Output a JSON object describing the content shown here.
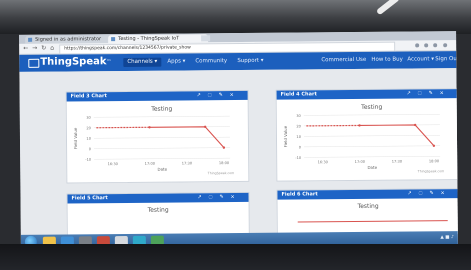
{
  "browser": {
    "tabs": [
      {
        "label": "Signed in as administrator"
      },
      {
        "label": "Testing - ThingSpeak IoT"
      }
    ],
    "url": "https://thingspeak.com/channels/1234567/private_show"
  },
  "header": {
    "logo": "ThingSpeak",
    "logo_mark": "™",
    "nav": [
      {
        "label": "Channels ▾"
      },
      {
        "label": "Apps ▾"
      },
      {
        "label": "Community"
      },
      {
        "label": "Support ▾"
      }
    ],
    "right_nav": [
      {
        "label": "Commercial Use"
      },
      {
        "label": "How to Buy"
      },
      {
        "label": "Account ▾"
      },
      {
        "label": "Sign Out"
      }
    ]
  },
  "panels": [
    {
      "title": "Field 3 Chart",
      "chart_data": {
        "type": "line",
        "title": "Testing",
        "xlabel": "Date",
        "ylabel": "Field Value",
        "x": [
          "17:00",
          "17:45",
          "18:00"
        ],
        "xticks": [
          "16:30",
          "17:00",
          "17:30",
          "18:00"
        ],
        "yticks": [
          "30",
          "20",
          "10",
          "0",
          "-10"
        ],
        "values": [
          20,
          20,
          0
        ],
        "ylim": [
          -10,
          30
        ],
        "credit": "ThingSpeak.com",
        "color": "#d9534f"
      }
    },
    {
      "title": "Field 4 Chart",
      "chart_data": {
        "type": "line",
        "title": "Testing",
        "xlabel": "Date",
        "ylabel": "Field Value",
        "x": [
          "17:00",
          "17:45",
          "18:00"
        ],
        "xticks": [
          "16:30",
          "17:00",
          "17:30",
          "18:00"
        ],
        "yticks": [
          "30",
          "20",
          "10",
          "0",
          "-10"
        ],
        "values": [
          20,
          20,
          0
        ],
        "ylim": [
          -10,
          30
        ],
        "credit": "ThingSpeak.com",
        "color": "#d9534f"
      }
    },
    {
      "title": "Field 5 Chart",
      "chart_title": "Testing"
    },
    {
      "title": "Field 6 Chart",
      "chart_title": "Testing"
    }
  ],
  "colors": {
    "brand": "#1c5fbd",
    "panel_header": "#1e64c6",
    "series": "#d9534f"
  }
}
